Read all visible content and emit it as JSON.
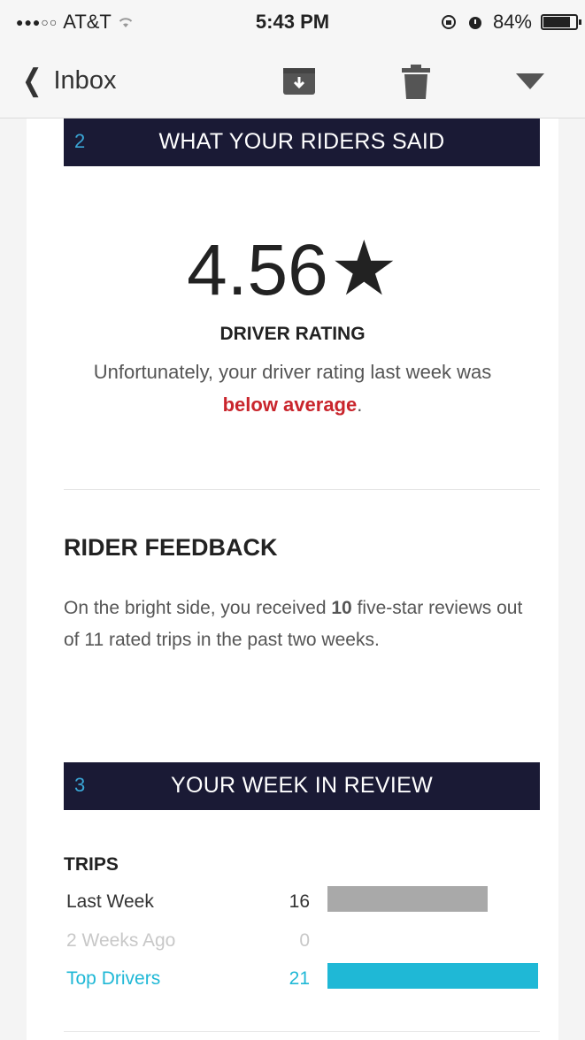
{
  "status_bar": {
    "carrier": "AT&T",
    "time": "5:43 PM",
    "battery": "84%",
    "battery_level": 0.84
  },
  "nav": {
    "back_label": "Inbox",
    "icons": [
      "archive-icon",
      "trash-icon",
      "dropdown-icon"
    ]
  },
  "section2": {
    "number": "2",
    "title": "WHAT YOUR RIDERS SAID",
    "rating": "4.56",
    "rating_label": "DRIVER RATING",
    "rating_text_pre": "Unfortunately, your driver rating last week was",
    "rating_text_highlight": "below average",
    "rating_text_post": ".",
    "feedback_title": "RIDER FEEDBACK",
    "feedback_pre": "On the bright side, you received",
    "feedback_count": "10",
    "feedback_post": "five-star reviews out of 11 rated trips in the past two weeks."
  },
  "section3": {
    "number": "3",
    "title": "YOUR WEEK IN REVIEW",
    "trips_title": "TRIPS",
    "trips": [
      {
        "label": "Last Week",
        "value": "16",
        "color": "#a9a9a9"
      },
      {
        "label": "2 Weeks Ago",
        "value": "0",
        "color": "#d9d9d9"
      },
      {
        "label": "Top Drivers",
        "value": "21",
        "color": "#1fb8d6"
      }
    ]
  },
  "colors": {
    "banner": "#1a1a35",
    "accent_blue": "#3aa6d6",
    "below_average": "#c9252c"
  }
}
